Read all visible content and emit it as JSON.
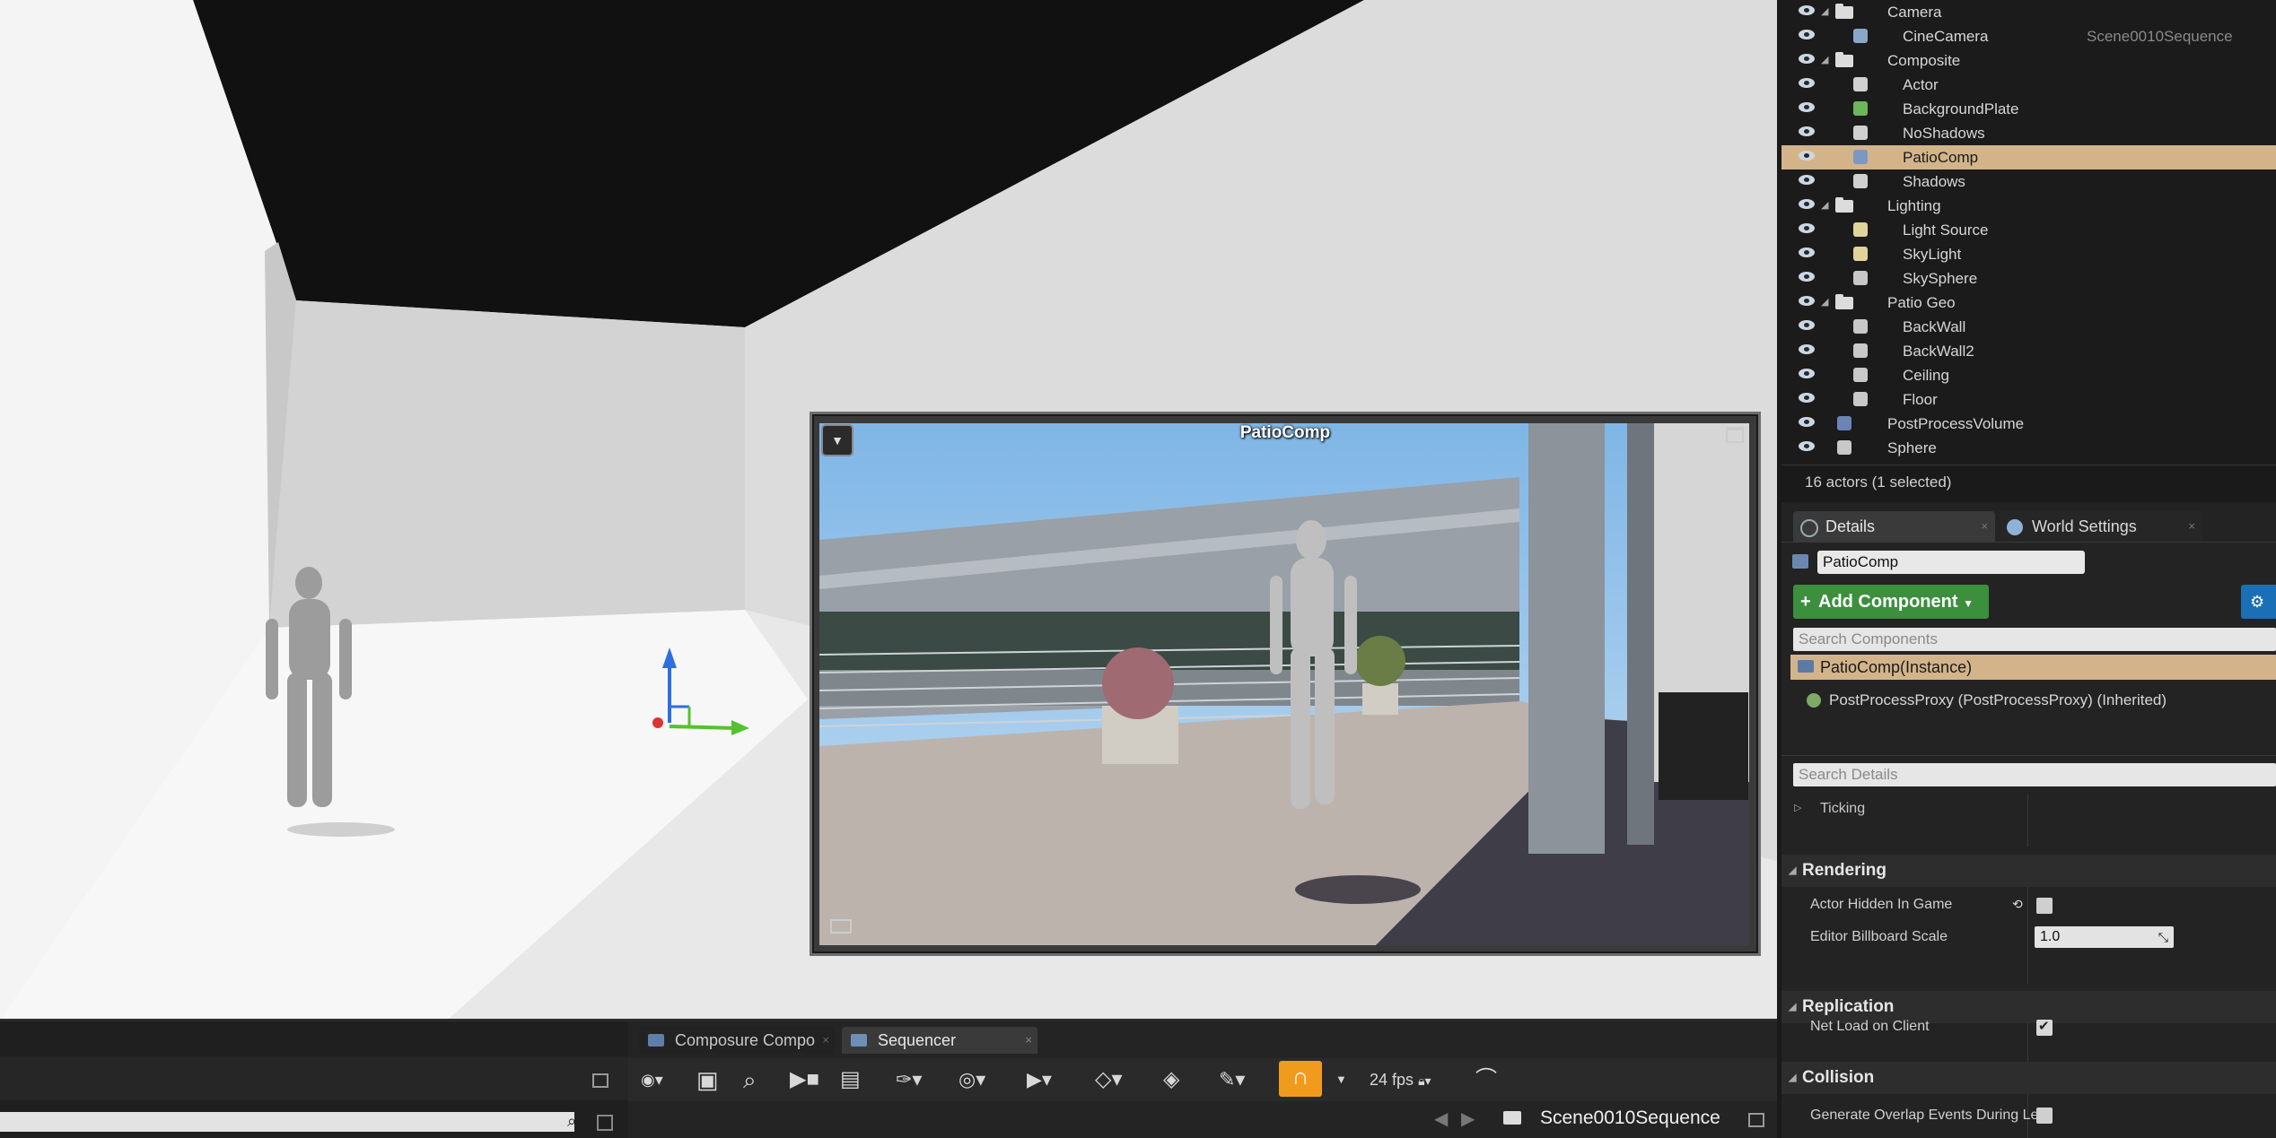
{
  "outliner": {
    "rows": [
      {
        "label": "Camera",
        "indent": 0,
        "type": "folder",
        "expanded": true
      },
      {
        "label": "CineCamera",
        "indent": 1,
        "type": "camera",
        "extra": "Scene0010Sequence"
      },
      {
        "label": "Composite",
        "indent": 0,
        "type": "folder",
        "expanded": true
      },
      {
        "label": "Actor",
        "indent": 1,
        "type": "actor"
      },
      {
        "label": "BackgroundPlate",
        "indent": 1,
        "type": "plate"
      },
      {
        "label": "NoShadows",
        "indent": 1,
        "type": "actor"
      },
      {
        "label": "PatioComp",
        "indent": 1,
        "type": "comp",
        "selected": true
      },
      {
        "label": "Shadows",
        "indent": 1,
        "type": "actor"
      },
      {
        "label": "Lighting",
        "indent": 0,
        "type": "folder",
        "expanded": true
      },
      {
        "label": "Light Source",
        "indent": 1,
        "type": "light"
      },
      {
        "label": "SkyLight",
        "indent": 1,
        "type": "light"
      },
      {
        "label": "SkySphere",
        "indent": 1,
        "type": "mesh"
      },
      {
        "label": "Patio Geo",
        "indent": 0,
        "type": "folder",
        "expanded": true
      },
      {
        "label": "BackWall",
        "indent": 1,
        "type": "mesh"
      },
      {
        "label": "BackWall2",
        "indent": 1,
        "type": "mesh"
      },
      {
        "label": "Ceiling",
        "indent": 1,
        "type": "mesh"
      },
      {
        "label": "Floor",
        "indent": 1,
        "type": "mesh"
      },
      {
        "label": "PostProcessVolume",
        "indent": 0,
        "type": "volume"
      },
      {
        "label": "Sphere",
        "indent": 0,
        "type": "mesh"
      }
    ],
    "status": "16 actors (1 selected)"
  },
  "details": {
    "tab_details": "Details",
    "tab_world": "World Settings",
    "name": "PatioComp",
    "add_component": "Add Component",
    "search_components_placeholder": "Search Components",
    "component_instance": "PatioComp(Instance)",
    "component_child": "PostProcessProxy (PostProcessProxy) (Inherited)",
    "search_details_placeholder": "Search Details",
    "ticking": "Ticking",
    "cat_rendering": "Rendering",
    "prop_hidden": "Actor Hidden In Game",
    "prop_billboard": "Editor Billboard Scale",
    "billboard_value": "1.0",
    "cat_replication": "Replication",
    "prop_netload": "Net Load on Client",
    "cat_collision": "Collision",
    "prop_overlap": "Generate Overlap Events During Le"
  },
  "preview": {
    "title": "PatioComp"
  },
  "sequencer": {
    "tab_composure": "Composure Compo",
    "tab_sequencer": "Sequencer",
    "fps": "24 fps",
    "sequence_name": "Scene0010Sequence"
  },
  "colors": {
    "selection": "#d3b48a",
    "add_button": "#3b8f3d",
    "magnet": "#f19b1d"
  }
}
